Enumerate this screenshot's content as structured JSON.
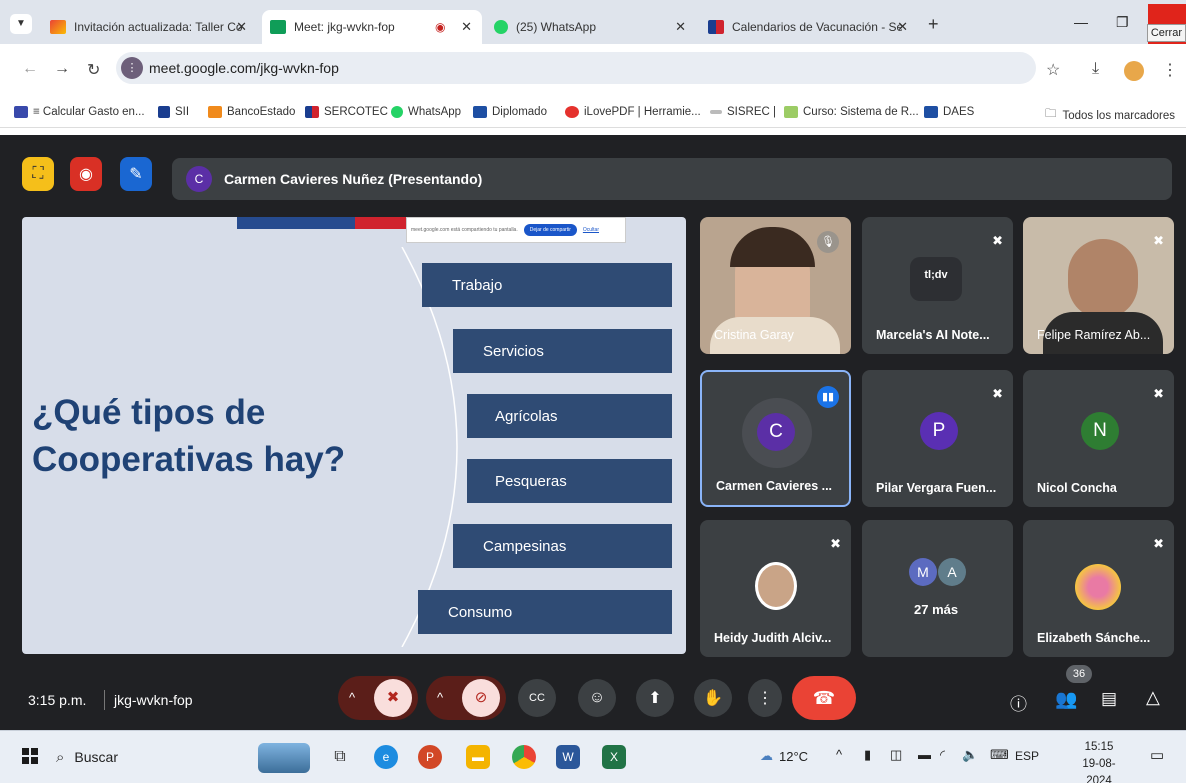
{
  "browser": {
    "tabs": [
      {
        "title": "Invitación actualizada: Taller Co",
        "active": false
      },
      {
        "title": "Meet: jkg-wvkn-fop",
        "active": true
      },
      {
        "title": "(25) WhatsApp",
        "active": false
      },
      {
        "title": "Calendarios de Vacunación - Se",
        "active": false
      }
    ],
    "new_tab": "+",
    "close_tooltip": "Cerrar",
    "url": "meet.google.com/jkg-wvkn-fop",
    "bookmarks": [
      "≡ Calcular Gasto en...",
      "SII",
      "BancoEstado",
      "SERCOTEC",
      "WhatsApp",
      "Diplomado",
      "iLovePDF | Herramie...",
      "SISREC |",
      "Curso: Sistema de R...",
      "DAES"
    ],
    "all_bookmarks": "Todos los marcadores"
  },
  "meet": {
    "presenter_initial": "C",
    "presenter_label": "Carmen Cavieres Nuñez (Presentando)",
    "share_notice": "meet.google.com está compartiendo tu pantalla.",
    "share_stop": "Dejar de compartir",
    "share_hide": "Ocultar",
    "slide_title": "¿Qué tipos de Cooperativas hay?",
    "slide_items": [
      "Trabajo",
      "Servicios",
      "Agrícolas",
      "Pesqueras",
      "Campesinas",
      "Consumo"
    ],
    "participants": [
      {
        "name": "Cristina Garay"
      },
      {
        "name": "Marcela's AI Note..."
      },
      {
        "name": "Felipe Ramírez Ab..."
      },
      {
        "name": "Carmen Cavieres ...",
        "initial": "C"
      },
      {
        "name": "Pilar Vergara Fuen...",
        "initial": "P"
      },
      {
        "name": "Nicol Concha",
        "initial": "N"
      },
      {
        "name": "Heidy Judith Alciv..."
      },
      {
        "name": "27 más",
        "initials": [
          "M",
          "A"
        ]
      },
      {
        "name": "Elizabeth Sánche..."
      }
    ],
    "tldv_logo": "tl;dv",
    "time": "3:15 p.m.",
    "meeting_code": "jkg-wvkn-fop",
    "participant_count": "36"
  },
  "taskbar": {
    "search_placeholder": "Buscar",
    "weather": "12°C",
    "language": "ESP",
    "clock_time": "15:15",
    "clock_date": "19-08-2024"
  },
  "colors": {
    "meet_bg": "#202124",
    "tile_bg": "#3c4043",
    "end_call": "#ea4335",
    "slide_box": "#2f4b74"
  }
}
